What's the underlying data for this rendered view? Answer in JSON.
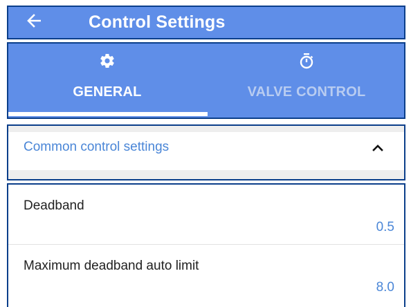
{
  "appbar": {
    "back_icon": "arrow-left-icon",
    "title": "Control Settings"
  },
  "tabs": [
    {
      "label": "GENERAL",
      "icon": "gear-icon",
      "active": true
    },
    {
      "label": "VALVE CONTROL",
      "icon": "stopwatch-icon",
      "active": false
    }
  ],
  "section": {
    "title": "Common control settings",
    "icon": "chevron-up-icon",
    "expanded": true
  },
  "settings": [
    {
      "label": "Deadband",
      "value": "0.5"
    },
    {
      "label": "Maximum deadband auto limit",
      "value": "8.0"
    }
  ],
  "colors": {
    "primary": "#5f8ee8",
    "accent_text": "#4a86d7",
    "outline": "#0a3e8a"
  }
}
